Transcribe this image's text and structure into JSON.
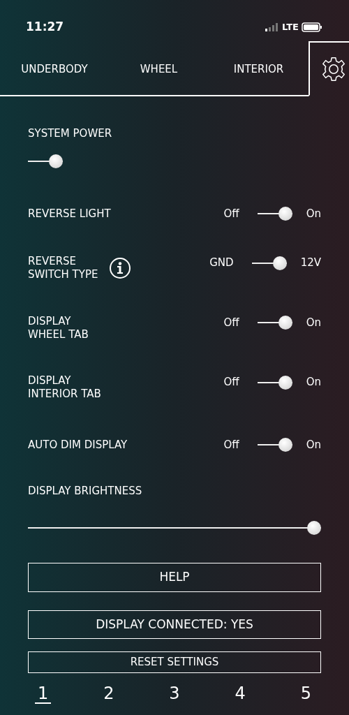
{
  "status_bar": {
    "time": "11:27",
    "network": "LTE"
  },
  "tabs": [
    {
      "label": "UNDERBODY",
      "kind": "text",
      "selected": false
    },
    {
      "label": "WHEEL",
      "kind": "text",
      "selected": false
    },
    {
      "label": "INTERIOR",
      "kind": "text",
      "selected": false
    },
    {
      "kind": "gear",
      "selected": true
    }
  ],
  "settings": [
    {
      "kind": "switch",
      "label": "SYSTEM POWER",
      "on": true
    },
    {
      "kind": "toggle",
      "label": "REVERSE LIGHT",
      "off_label": "Off",
      "on_label": "On",
      "on": true
    },
    {
      "kind": "toggle",
      "label": "REVERSE\nSWITCH TYPE",
      "info": true,
      "off_label": "GND",
      "on_label": "12V",
      "on": true
    },
    {
      "kind": "toggle",
      "label": "DISPLAY\nWHEEL TAB",
      "off_label": "Off",
      "on_label": "On",
      "on": true
    },
    {
      "kind": "toggle",
      "label": "DISPLAY\nINTERIOR TAB",
      "off_label": "Off",
      "on_label": "On",
      "on": true
    },
    {
      "kind": "toggle",
      "label": "AUTO DIM DISPLAY",
      "off_label": "Off",
      "on_label": "On",
      "on": true
    },
    {
      "kind": "slider",
      "label": "DISPLAY BRIGHTNESS",
      "level": 1
    }
  ],
  "buttons": [
    "HELP",
    "DISPLAY CONNECTED: YES",
    "RESET SETTINGS"
  ],
  "pages": [
    {
      "label": "1",
      "selected": true
    },
    {
      "label": "2",
      "selected": false
    },
    {
      "label": "3",
      "selected": false
    },
    {
      "label": "4",
      "selected": false
    },
    {
      "label": "5",
      "selected": false
    }
  ]
}
